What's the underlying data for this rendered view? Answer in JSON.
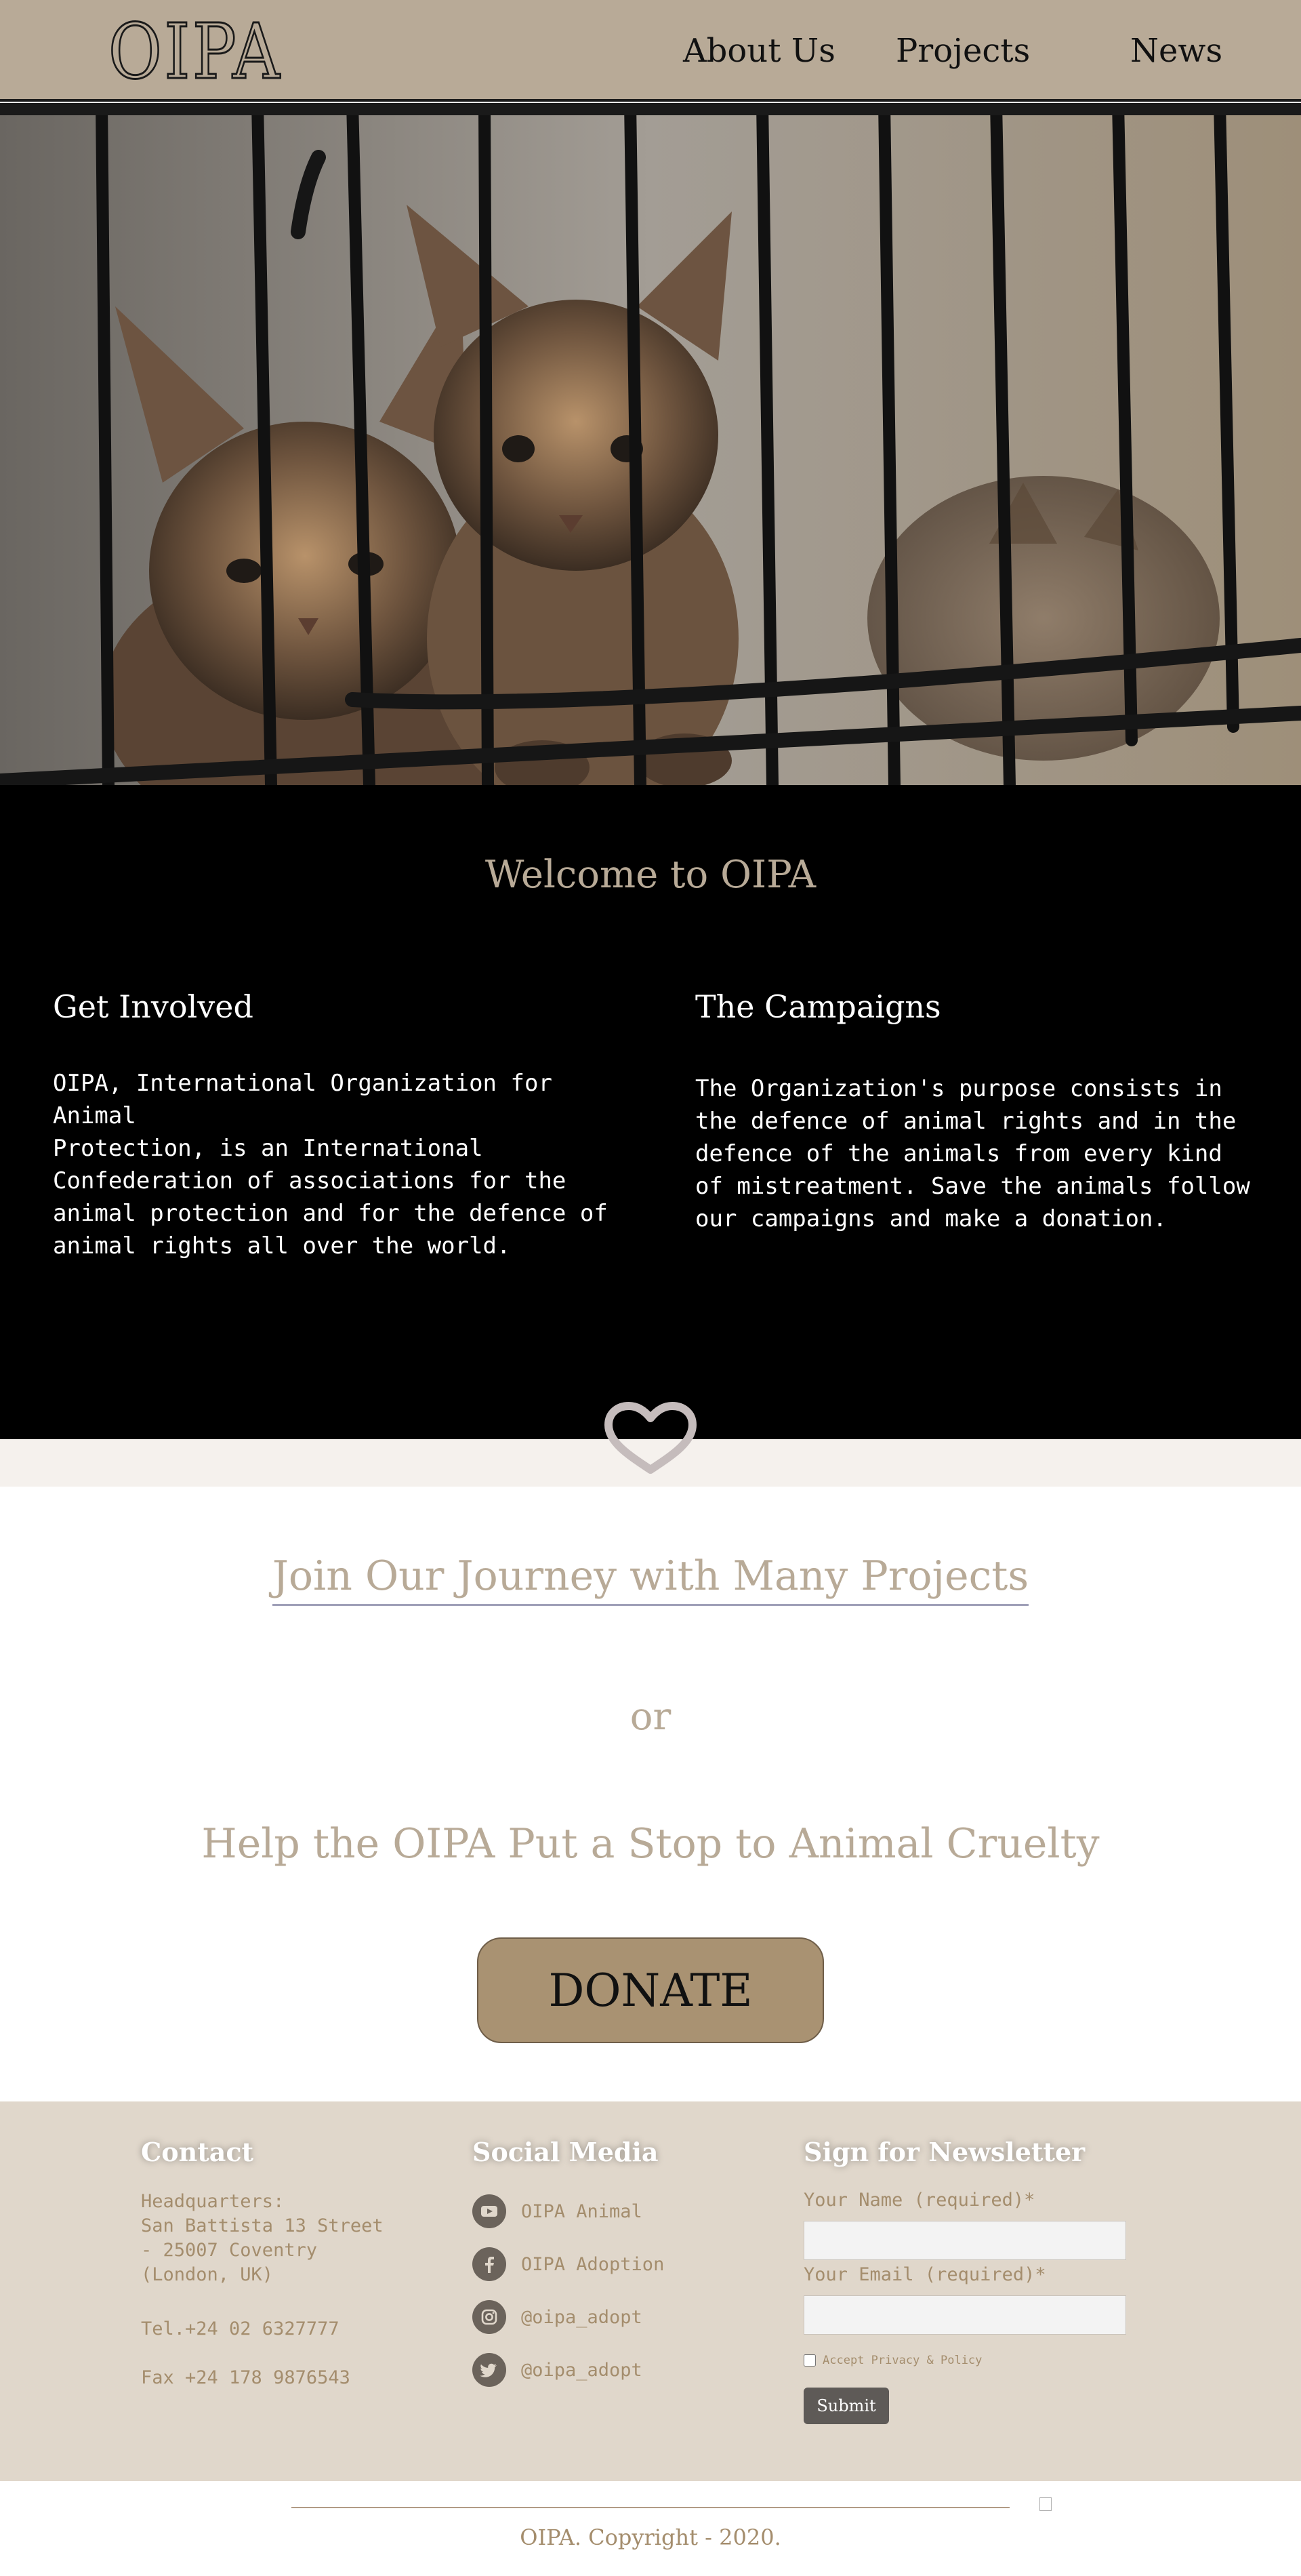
{
  "header": {
    "logo": "OIPA",
    "nav": {
      "about": "About Us",
      "projects": "Projects",
      "news": "News"
    }
  },
  "hero": {
    "image": "kittens-in-cage-photo"
  },
  "welcome": {
    "title": "Welcome to OIPA",
    "left": {
      "title": "Get Involved",
      "text": "OIPA, International Organization for\nAnimal\nProtection, is an International\nConfederation of associations for the\nanimal protection and for the defence of\nanimal rights all over the world."
    },
    "right": {
      "title": "The Campaigns",
      "text": "The Organization's purpose consists in\nthe defence of animal rights and in the\ndefence of the animals from every kind\nof mistreatment. Save the animals follow\nour campaigns and make a donation."
    }
  },
  "cta": {
    "link": "Join Our Journey with Many Projects",
    "or": "or",
    "help": "Help the OIPA Put a Stop to Animal Cruelty",
    "donate": "DONATE"
  },
  "footer": {
    "contact": {
      "title": "Contact",
      "address": "Headquarters:\nSan Battista 13 Street\n- 25007 Coventry\n(London, UK)",
      "tel": "Tel.+24 02 6327777",
      "fax": "Fax +24 178 9876543"
    },
    "social": {
      "title": "Social Media",
      "items": [
        {
          "label": "OIPA Animal",
          "icon": "youtube-icon"
        },
        {
          "label": "OIPA Adoption",
          "icon": "facebook-icon"
        },
        {
          "label": "@oipa_adopt",
          "icon": "instagram-icon"
        },
        {
          "label": "@oipa_adopt",
          "icon": "twitter-icon"
        }
      ]
    },
    "newsletter": {
      "title": "Sign for Newsletter",
      "name_label": "Your Name (required)*",
      "name_value": "",
      "email_label": "Your Email (required)*",
      "email_value": "",
      "privacy": "Accept Privacy & Policy",
      "submit": "Submit"
    }
  },
  "copyright": "OIPA. Copyright - 2020.",
  "colors": {
    "header_bg": "#b8aa97",
    "accent": "#b8aa97",
    "donate_bg": "#a99272",
    "footer_bg": "#e0d7cb",
    "footer_text": "#a48d6d"
  }
}
